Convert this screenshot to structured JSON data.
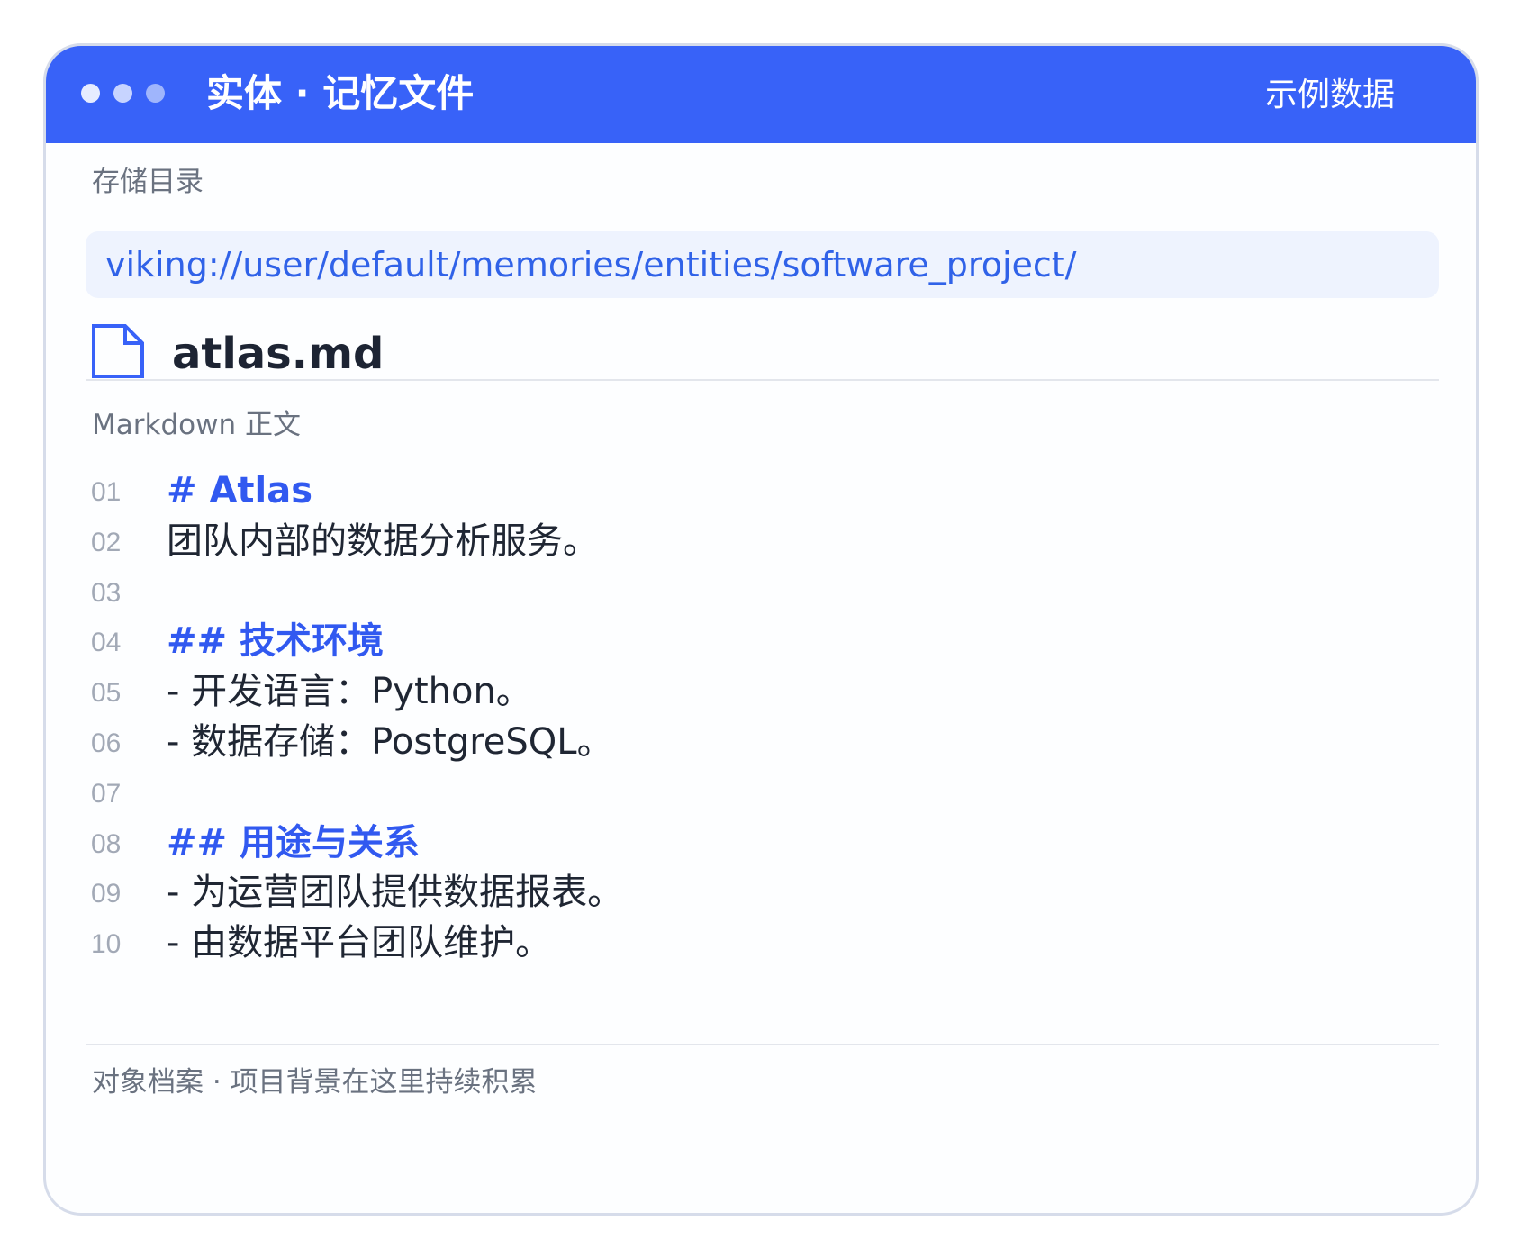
{
  "window": {
    "title": "实体 · 记忆文件",
    "tag": "示例数据"
  },
  "storage": {
    "label": "存储目录",
    "path": "viking://user/default/memories/entities/software_project/"
  },
  "file": {
    "icon": "file-icon",
    "name": "atlas.md"
  },
  "markdown": {
    "label": "Markdown 正文",
    "lines": [
      {
        "num": "01",
        "text": "# Atlas",
        "kind": "heading"
      },
      {
        "num": "02",
        "text": "团队内部的数据分析服务。",
        "kind": "text"
      },
      {
        "num": "03",
        "text": "",
        "kind": "text"
      },
      {
        "num": "04",
        "text": "## 技术环境",
        "kind": "heading"
      },
      {
        "num": "05",
        "text": "- 开发语言：Python。",
        "kind": "text"
      },
      {
        "num": "06",
        "text": "- 数据存储：PostgreSQL。",
        "kind": "text"
      },
      {
        "num": "07",
        "text": "",
        "kind": "text"
      },
      {
        "num": "08",
        "text": "## 用途与关系",
        "kind": "heading"
      },
      {
        "num": "09",
        "text": "- 为运营团队提供数据报表。",
        "kind": "text"
      },
      {
        "num": "10",
        "text": "- 由数据平台团队维护。",
        "kind": "text"
      }
    ]
  },
  "footer": {
    "text": "对象档案 · 项目背景在这里持续积累"
  },
  "colors": {
    "accent": "#3862f8",
    "heading": "#3159f0",
    "path_bg": "#eef3fe"
  }
}
